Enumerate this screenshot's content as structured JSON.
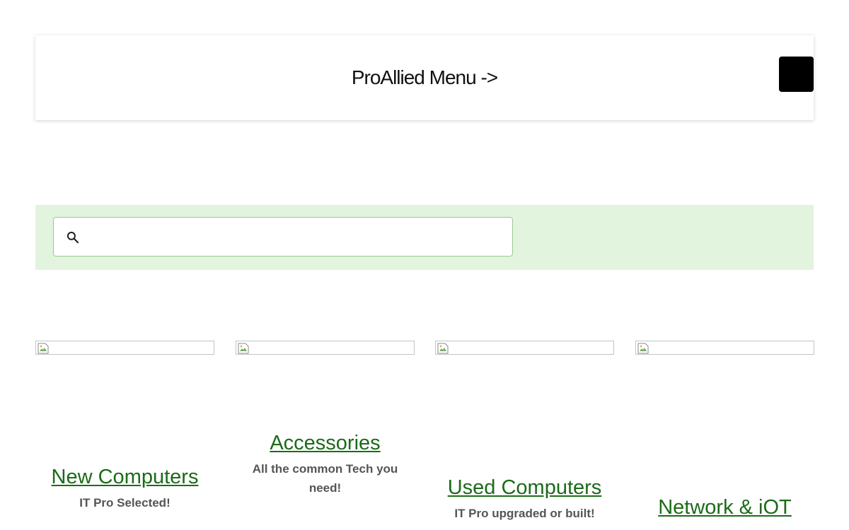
{
  "header": {
    "title": "ProAllied Menu ->",
    "menu_button_label": ""
  },
  "search": {
    "placeholder": "",
    "value": "",
    "icon": "search-icon"
  },
  "categories": [
    {
      "title": "New Computers",
      "subtitle": "IT Pro Selected!"
    },
    {
      "title": "Accessories",
      "subtitle": "All the common Tech you need!"
    },
    {
      "title": "Used Computers",
      "subtitle": "IT Pro upgraded or built!"
    },
    {
      "title": "Network & iOT",
      "subtitle": ""
    }
  ],
  "colors": {
    "accent_green": "#1b6b18",
    "search_band": "#e2f4dd",
    "menu_button": "#000000"
  }
}
